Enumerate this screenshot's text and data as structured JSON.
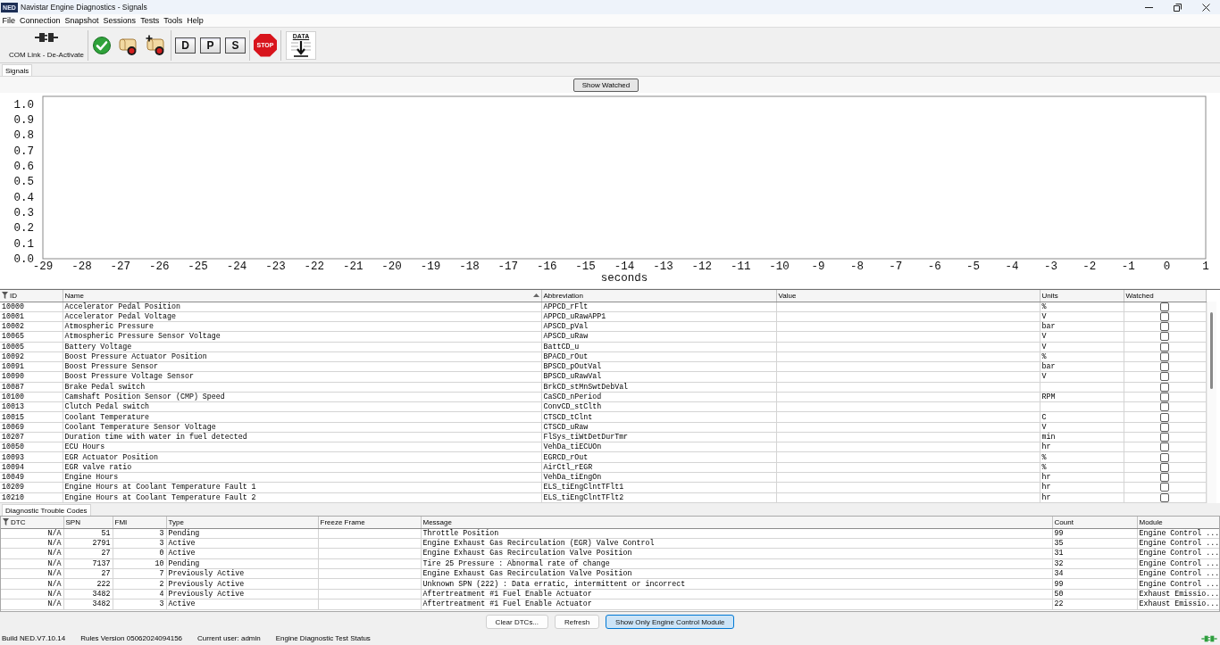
{
  "window": {
    "icon_label": "NED",
    "title": "Navistar Engine Diagnostics - Signals"
  },
  "menu": [
    "File",
    "Connection",
    "Snapshot",
    "Sessions",
    "Tests",
    "Tools",
    "Help"
  ],
  "toolbar_groups": [
    [
      {
        "kind": "com_link",
        "label": "COM Link - De-Activate"
      }
    ],
    [
      {
        "kind": "check"
      },
      {
        "kind": "scroll"
      },
      {
        "kind": "scroll_add"
      }
    ],
    [
      {
        "kind": "letter",
        "label": "D"
      },
      {
        "kind": "letter",
        "label": "P"
      },
      {
        "kind": "letter",
        "label": "S"
      }
    ],
    [
      {
        "kind": "stop",
        "label": "STOP"
      }
    ],
    [
      {
        "kind": "data",
        "label": "DATA"
      }
    ]
  ],
  "signals_tabs": [
    {
      "label": "Signals",
      "selected": true
    }
  ],
  "show_watched_button": "Show Watched",
  "chart": {
    "chart_data": {
      "type": "line",
      "xlabel": "seconds",
      "xlim": [
        -29,
        1
      ],
      "ylim": [
        0,
        1.05
      ],
      "xticks": [
        -29,
        -28,
        -27,
        -26,
        -25,
        -24,
        -23,
        -22,
        -21,
        -20,
        -19,
        -18,
        -17,
        -16,
        -15,
        -14,
        -13,
        -12,
        -11,
        -10,
        -9,
        -8,
        -7,
        -6,
        -5,
        -4,
        -3,
        -2,
        -1,
        0,
        1
      ],
      "yticks": [
        {
          "value": 0,
          "label": "0.0"
        },
        0.1,
        0.2,
        0.3,
        0.4,
        0.5,
        0.6,
        0.7,
        0.8,
        0.9,
        {
          "value": 1,
          "label": "1.0"
        }
      ]
    }
  },
  "signals_table": {
    "columns": [
      {
        "label": "ID",
        "sorted_ascending": false
      },
      {
        "label": "Name",
        "sorted_ascending": true
      },
      {
        "label": "Abbreviation",
        "sorted_ascending": false
      },
      {
        "label": "Value",
        "sorted_ascending": false
      },
      {
        "label": "Units",
        "sorted_ascending": false
      },
      {
        "label": "Watched",
        "sorted_ascending": false
      }
    ],
    "rows": [
      {
        "id": "10000",
        "name": "Accelerator Pedal Position",
        "abbreviation": "APPCD_rFlt",
        "units": "%",
        "watched": false
      },
      {
        "id": "10001",
        "name": "Accelerator Pedal Voltage",
        "abbreviation": "APPCD_uRawAPP1",
        "units": "V",
        "watched": false
      },
      {
        "id": "10002",
        "name": "Atmospheric Pressure",
        "abbreviation": "APSCD_pVal",
        "units": "bar",
        "watched": false
      },
      {
        "id": "10065",
        "name": "Atmospheric Pressure Sensor Voltage",
        "abbreviation": "APSCD_uRaw",
        "units": "V",
        "watched": false
      },
      {
        "id": "10005",
        "name": "Battery Voltage",
        "abbreviation": "BattCD_u",
        "units": "V",
        "watched": false
      },
      {
        "id": "10092",
        "name": "Boost Pressure Actuator Position",
        "abbreviation": "BPACD_rOut",
        "units": "%",
        "watched": false
      },
      {
        "id": "10091",
        "name": "Boost Pressure Sensor",
        "abbreviation": "BPSCD_pOutVal",
        "units": "bar",
        "watched": false
      },
      {
        "id": "10090",
        "name": "Boost Pressure Voltage Sensor",
        "abbreviation": "BPSCD_uRawVal",
        "units": "V",
        "watched": false
      },
      {
        "id": "10087",
        "name": "Brake Pedal switch",
        "abbreviation": "BrkCD_stMnSwtDebVal",
        "watched": false
      },
      {
        "id": "10100",
        "name": "Camshaft Position Sensor (CMP) Speed",
        "abbreviation": "CaSCD_nPeriod",
        "units": "RPM",
        "watched": false
      },
      {
        "id": "10013",
        "name": "Clutch Pedal switch",
        "abbreviation": "ConvCD_stClth",
        "watched": false
      },
      {
        "id": "10015",
        "name": "Coolant Temperature",
        "abbreviation": "CTSCD_tClnt",
        "units": "C",
        "watched": false
      },
      {
        "id": "10069",
        "name": "Coolant Temperature Sensor Voltage",
        "abbreviation": "CTSCD_uRaw",
        "units": "V",
        "watched": false
      },
      {
        "id": "10207",
        "name": "Duration time with water in fuel detected",
        "abbreviation": "FlSys_tiWtDetDurTmr",
        "units": "min",
        "watched": false
      },
      {
        "id": "10050",
        "name": "ECU Hours",
        "abbreviation": "VehDa_tiECUOn",
        "units": "hr",
        "watched": false
      },
      {
        "id": "10093",
        "name": "EGR Actuator Position",
        "abbreviation": "EGRCD_rOut",
        "units": "%",
        "watched": false
      },
      {
        "id": "10094",
        "name": "EGR valve ratio",
        "abbreviation": "AirCtl_rEGR",
        "units": "%",
        "watched": false
      },
      {
        "id": "10049",
        "name": "Engine Hours",
        "abbreviation": "VehDa_tiEngOn",
        "units": "hr",
        "watched": false
      },
      {
        "id": "10209",
        "name": "Engine Hours at Coolant Temperature Fault 1",
        "abbreviation": "ELS_tiEngClntTFlt1",
        "units": "hr",
        "watched": false
      },
      {
        "id": "10210",
        "name": "Engine Hours at Coolant Temperature Fault 2",
        "abbreviation": "ELS_tiEngClntTFlt2",
        "units": "hr",
        "watched": false
      }
    ]
  },
  "dtc_tabs": [
    {
      "label": "Diagnostic Trouble Codes",
      "selected": true
    }
  ],
  "dtc_table": {
    "columns": [
      "DTC",
      "SPN",
      "FMI",
      "Type",
      "Freeze Frame",
      "Message",
      "Count",
      "Module"
    ],
    "rows": [
      {
        "dtc": "N/A",
        "spn": "51",
        "fmi": "3",
        "type": "Pending",
        "message": "Throttle Position",
        "count": "99",
        "module": "Engine Control ..."
      },
      {
        "dtc": "N/A",
        "spn": "2791",
        "fmi": "3",
        "type": "Active",
        "message": "Engine Exhaust Gas Recirculation (EGR) Valve Control",
        "count": "35",
        "module": "Engine Control ..."
      },
      {
        "dtc": "N/A",
        "spn": "27",
        "fmi": "0",
        "type": "Active",
        "message": "Engine Exhaust Gas Recirculation Valve Position",
        "count": "31",
        "module": "Engine Control ..."
      },
      {
        "dtc": "N/A",
        "spn": "7137",
        "fmi": "10",
        "type": "Pending",
        "message": "Tire 25 Pressure : Abnormal rate of change",
        "count": "32",
        "module": "Engine Control ..."
      },
      {
        "dtc": "N/A",
        "spn": "27",
        "fmi": "7",
        "type": "Previously Active",
        "message": "Engine Exhaust Gas Recirculation Valve Position",
        "count": "34",
        "module": "Engine Control ..."
      },
      {
        "dtc": "N/A",
        "spn": "222",
        "fmi": "2",
        "type": "Previously Active",
        "message": "Unknown SPN (222) : Data erratic, intermittent or incorrect",
        "count": "99",
        "module": "Engine Control ..."
      },
      {
        "dtc": "N/A",
        "spn": "3482",
        "fmi": "4",
        "type": "Previously Active",
        "message": "Aftertreatment #1 Fuel Enable Actuator",
        "count": "50",
        "module": "Exhaust Emissio..."
      },
      {
        "dtc": "N/A",
        "spn": "3482",
        "fmi": "3",
        "type": "Active",
        "message": "Aftertreatment #1 Fuel Enable Actuator",
        "count": "22",
        "module": "Exhaust Emissio..."
      }
    ]
  },
  "dtc_buttons": [
    {
      "label": "Clear DTCs...",
      "highlighted": false
    },
    {
      "label": "Refresh",
      "highlighted": false
    },
    {
      "label": "Show Only Engine Control Module",
      "highlighted": true
    }
  ],
  "status_bar": [
    "Build NED.V7.10.14",
    "Rules Version 05062024094156",
    "Current user: admin",
    "Engine Diagnostic Test Status"
  ]
}
